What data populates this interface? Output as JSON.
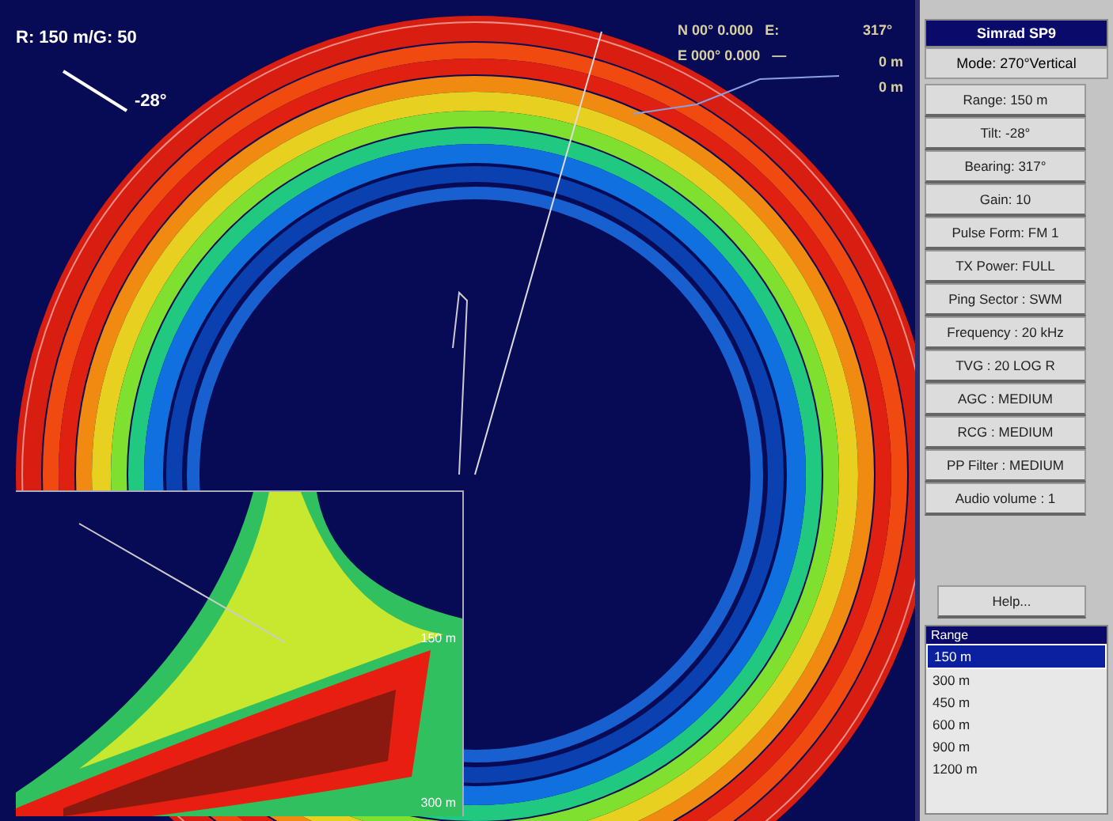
{
  "display": {
    "range_gain": "R: 150 m/G: 50",
    "tilt": "-28°",
    "position_lines": [
      "N 00° 0.000   E:",
      "E 000° 0.000   —"
    ],
    "bearing": "317°",
    "depths": [
      "0 m",
      "0 m"
    ],
    "inset_labels": [
      "150 m",
      "300 m"
    ]
  },
  "panel": {
    "title": "Simrad SP9",
    "mode": "Mode: 270°Vertical",
    "buttons": [
      "Range: 150 m",
      "Tilt: -28°",
      "Bearing: 317°",
      "Gain: 10",
      "Pulse Form: FM 1",
      "TX Power: FULL",
      "Ping Sector : SWM",
      "Frequency : 20 kHz",
      "TVG : 20 LOG R",
      "AGC : MEDIUM",
      "RCG : MEDIUM",
      "PP Filter : MEDIUM",
      "Audio volume : 1"
    ],
    "help": "Help...",
    "list": {
      "header": "Range",
      "items": [
        {
          "label": "150 m",
          "selected": true
        },
        {
          "label": "300 m",
          "selected": false
        },
        {
          "label": "450 m",
          "selected": false
        },
        {
          "label": "600 m",
          "selected": false
        },
        {
          "label": "900 m",
          "selected": false
        },
        {
          "label": "1200 m",
          "selected": false
        }
      ]
    }
  }
}
